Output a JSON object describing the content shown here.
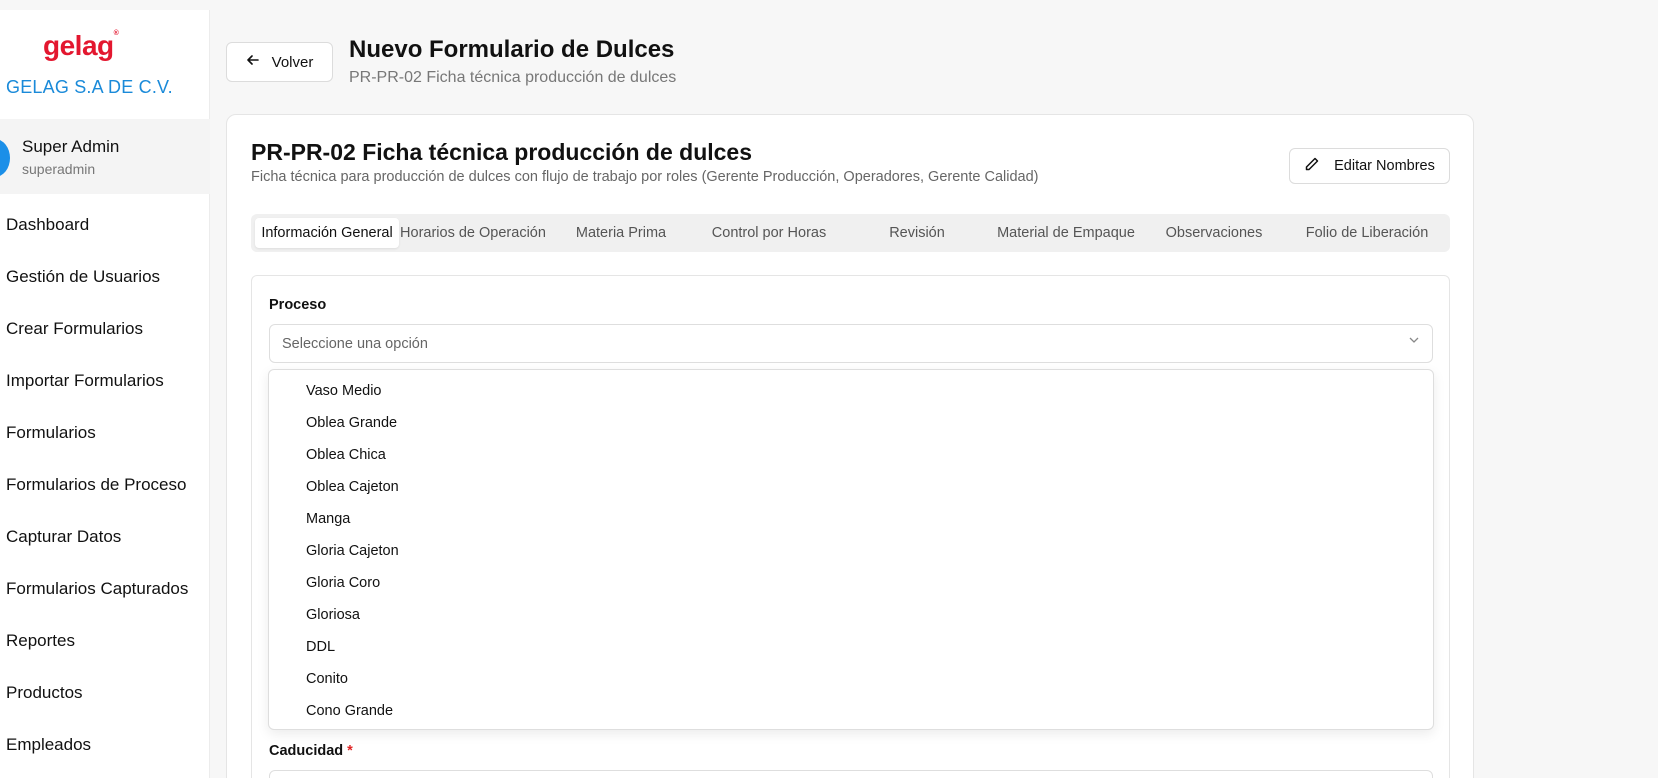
{
  "sidebar": {
    "logo": "gelag",
    "logo_mark": "®",
    "company": "GELAG S.A DE C.V.",
    "user": {
      "name": "Super Admin",
      "role": "superadmin"
    },
    "items": [
      {
        "label": "Dashboard"
      },
      {
        "label": "Gestión de Usuarios"
      },
      {
        "label": "Crear Formularios"
      },
      {
        "label": "Importar Formularios"
      },
      {
        "label": "Formularios"
      },
      {
        "label": "Formularios de Proceso"
      },
      {
        "label": "Capturar Datos"
      },
      {
        "label": "Formularios Capturados"
      },
      {
        "label": "Reportes"
      },
      {
        "label": "Productos"
      },
      {
        "label": "Empleados"
      }
    ]
  },
  "header": {
    "back_label": "Volver",
    "title": "Nuevo Formulario de Dulces",
    "subtitle": "PR-PR-02 Ficha técnica producción de dulces"
  },
  "card": {
    "title": "PR-PR-02 Ficha técnica producción de dulces",
    "description": "Ficha técnica para producción de dulces con flujo de trabajo por roles (Gerente Producción, Operadores, Gerente Calidad)",
    "edit_label": "Editar Nombres",
    "tabs": [
      {
        "label": "Información General"
      },
      {
        "label": "Horarios de Operación"
      },
      {
        "label": "Materia Prima"
      },
      {
        "label": "Control por Horas"
      },
      {
        "label": "Revisión"
      },
      {
        "label": "Material de Empaque"
      },
      {
        "label": "Observaciones"
      },
      {
        "label": "Folio de Liberación"
      }
    ]
  },
  "form": {
    "proceso_label": "Proceso",
    "proceso_placeholder": "Seleccione una opción",
    "caducidad_label": "Caducidad",
    "required_mark": "*"
  },
  "dropdown": {
    "options": [
      "Vaso Medio",
      "Oblea Grande",
      "Oblea Chica",
      "Oblea Cajeton",
      "Manga",
      "Gloria Cajeton",
      "Gloria Coro",
      "Gloriosa",
      "DDL",
      "Conito",
      "Cono Grande"
    ]
  },
  "icons": {
    "back": "arrow-left-icon",
    "edit": "pencil-icon",
    "select": "chevron-down-icon"
  }
}
